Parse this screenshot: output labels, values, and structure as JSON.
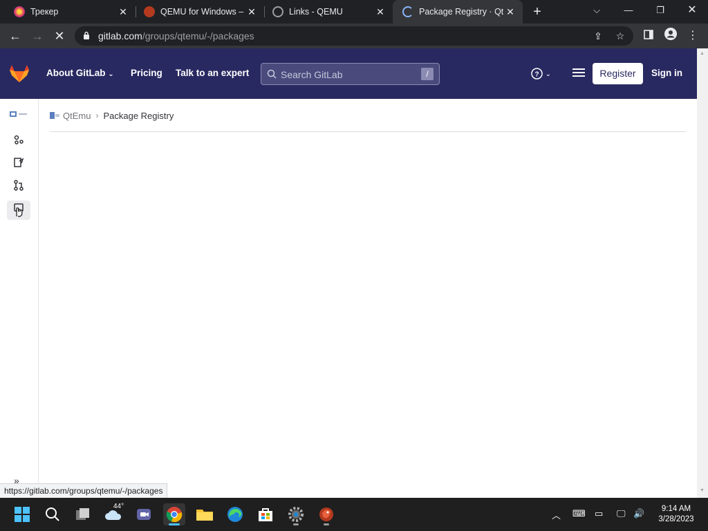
{
  "browser": {
    "tabs": [
      {
        "title": "Трекер",
        "favicon_color": "#d6336c"
      },
      {
        "title": "QEMU for Windows – In",
        "favicon_color": "#b33a1f"
      },
      {
        "title": "Links - QEMU",
        "favicon_color": "#9aa0a6"
      },
      {
        "title": "Package Registry · QtEmu",
        "favicon_color": "#8ab4f8",
        "active": true
      }
    ],
    "url_host": "gitlab.com",
    "url_path": "/groups/qtemu/-/packages",
    "status_url": "https://gitlab.com/groups/qtemu/-/packages"
  },
  "gitlab": {
    "nav": {
      "about": "About GitLab",
      "pricing": "Pricing",
      "talk": "Talk to an expert"
    },
    "search_placeholder": "Search GitLab",
    "search_shortcut": "/",
    "register": "Register",
    "sign_in": "Sign in",
    "breadcrumb": {
      "group": "QtEmu",
      "current": "Package Registry"
    }
  },
  "taskbar": {
    "weather_temp": "44°",
    "time": "9:14 AM",
    "date": "3/28/2023"
  },
  "colors": {
    "gitlab_header": "#292961",
    "tab_bar": "#202124",
    "toolbar": "#35363a",
    "taskbar": "#1f1f1f"
  }
}
